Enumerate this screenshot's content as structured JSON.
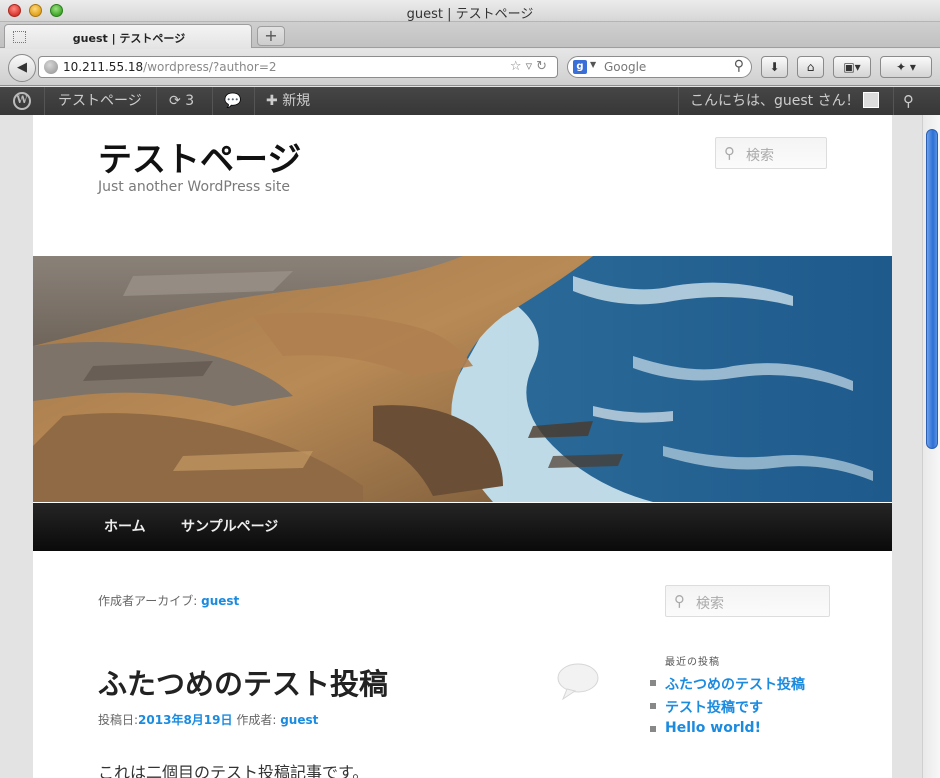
{
  "window": {
    "title": "guest | テストページ",
    "tab_label": "guest | テストページ",
    "new_tab": "+"
  },
  "toolbar": {
    "url_host": "10.211.55.18",
    "url_path": "/wordpress/?author=2",
    "search_placeholder": "Google",
    "search_engine_letter": "g"
  },
  "adminbar": {
    "site_name": "テストページ",
    "updates_count": "3",
    "new_label": "新規",
    "greeting": "こんにちは、guest さん！"
  },
  "site": {
    "title": "テストページ",
    "description": "Just another WordPress site",
    "search_placeholder": "検索"
  },
  "nav": {
    "items": [
      {
        "label": "ホーム"
      },
      {
        "label": "サンプルページ"
      }
    ]
  },
  "archive": {
    "prefix": "作成者アーカイブ: ",
    "author": "guest"
  },
  "post": {
    "title": "ふたつめのテスト投稿",
    "date_prefix": "投稿日:",
    "date": "2013年8月19日",
    "author_prefix": " 作成者: ",
    "author": "guest",
    "body": "これは二個目のテスト投稿記事です。"
  },
  "sidebar": {
    "search_placeholder": "検索",
    "recent_title": "最近の投稿",
    "recent_posts": [
      {
        "label": "ふたつめのテスト投稿"
      },
      {
        "label": "テスト投稿です"
      },
      {
        "label": "Hello world!"
      }
    ]
  }
}
